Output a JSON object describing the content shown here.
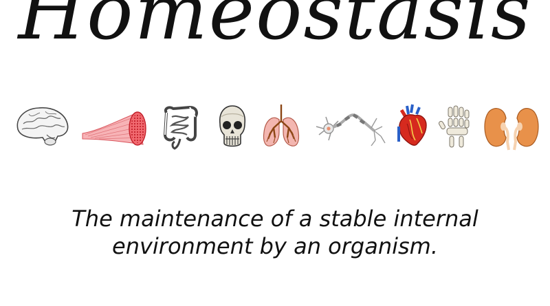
{
  "title": "Homeostasis",
  "organs": [
    {
      "name": "brain",
      "icon": "brain-icon"
    },
    {
      "name": "muscle",
      "icon": "muscle-icon"
    },
    {
      "name": "intestines",
      "icon": "intestines-icon"
    },
    {
      "name": "skull",
      "icon": "skull-icon"
    },
    {
      "name": "lungs",
      "icon": "lungs-icon"
    },
    {
      "name": "neuron",
      "icon": "neuron-icon"
    },
    {
      "name": "heart",
      "icon": "heart-icon"
    },
    {
      "name": "hand-bones",
      "icon": "hand-bones-icon"
    },
    {
      "name": "kidneys",
      "icon": "kidneys-icon"
    }
  ],
  "definition": {
    "line1": "The maintenance of a stable internal",
    "line2": "environment by an organism."
  },
  "colors": {
    "text": "#111111",
    "muscle": "#e8474f",
    "heart": "#d62a1e",
    "lungs": "#a0522d",
    "kidneys": "#e8914a"
  }
}
